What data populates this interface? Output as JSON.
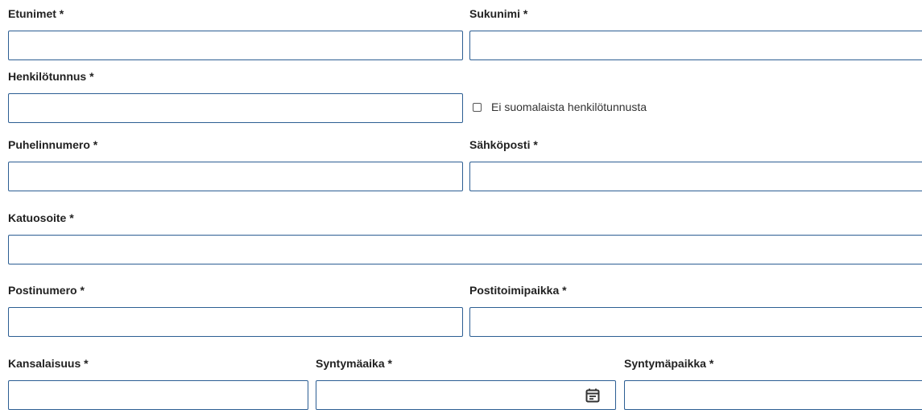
{
  "form": {
    "first_names": {
      "label": "Etunimet *",
      "value": ""
    },
    "last_name": {
      "label": "Sukunimi *",
      "value": ""
    },
    "personal_id": {
      "label": "Henkilötunnus *",
      "value": ""
    },
    "no_finnish_id": {
      "label": "Ei suomalaista henkilötunnusta",
      "checked": false
    },
    "phone": {
      "label": "Puhelinnumero *",
      "value": ""
    },
    "email": {
      "label": "Sähköposti *",
      "value": ""
    },
    "street_address": {
      "label": "Katuosoite *",
      "value": ""
    },
    "postal_code": {
      "label": "Postinumero *",
      "value": ""
    },
    "post_office": {
      "label": "Postitoimipaikka *",
      "value": ""
    },
    "citizenship": {
      "label": "Kansalaisuus *",
      "value": ""
    },
    "birth_date": {
      "label": "Syntymäaika *",
      "value": "",
      "icon": "calendar-icon"
    },
    "birth_place": {
      "label": "Syntymäpaikka *",
      "value": ""
    }
  },
  "colors": {
    "input_border": "#2c5e93",
    "label_text": "#222222",
    "background": "#ffffff"
  }
}
